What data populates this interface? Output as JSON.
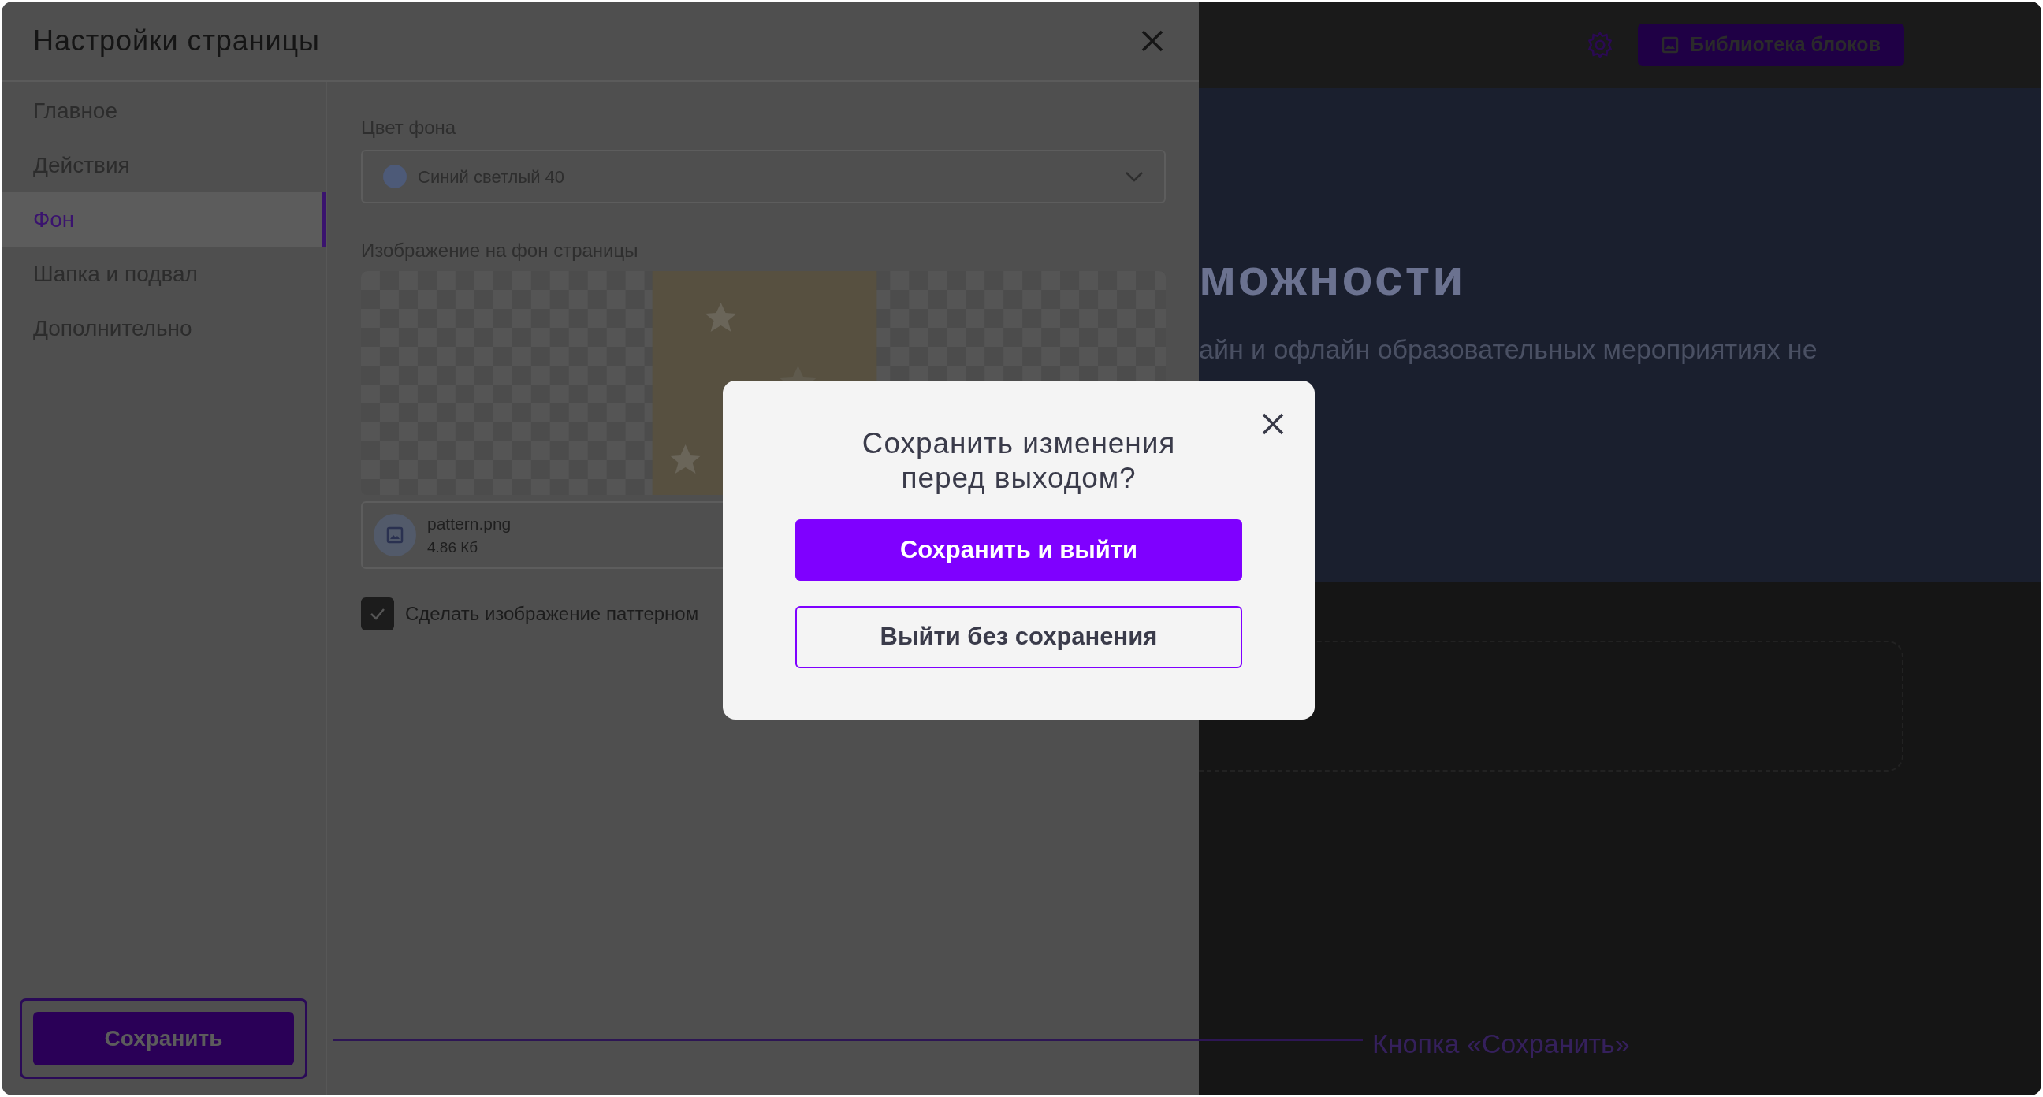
{
  "settings_panel": {
    "title": "Настройки страницы",
    "sidebar": {
      "items": [
        {
          "label": "Главное",
          "selected": false
        },
        {
          "label": "Действия",
          "selected": false
        },
        {
          "label": "Фон",
          "selected": true
        },
        {
          "label": "Шапка и подвал",
          "selected": false
        },
        {
          "label": "Дополнительно",
          "selected": false
        }
      ]
    },
    "background_color": {
      "label": "Цвет фона",
      "value": "Синий светлый 40"
    },
    "background_image": {
      "label": "Изображение на фон страницы",
      "file": {
        "name": "pattern.png",
        "size": "4.86 Кб"
      }
    },
    "pattern_checkbox": {
      "label": "Сделать изображение паттерном",
      "checked": true
    },
    "save_button": "Сохранить"
  },
  "editor": {
    "library_button": "Библиотека блоков",
    "heading": "можности",
    "subtitle": "айн и офлайн образовательных мероприятиях не"
  },
  "dialog": {
    "title": "Сохранить изменения перед выходом?",
    "primary_button": "Сохранить и выйти",
    "secondary_button": "Выйти без сохранения"
  },
  "annotation": {
    "label": "Кнопка «Сохранить»"
  }
}
